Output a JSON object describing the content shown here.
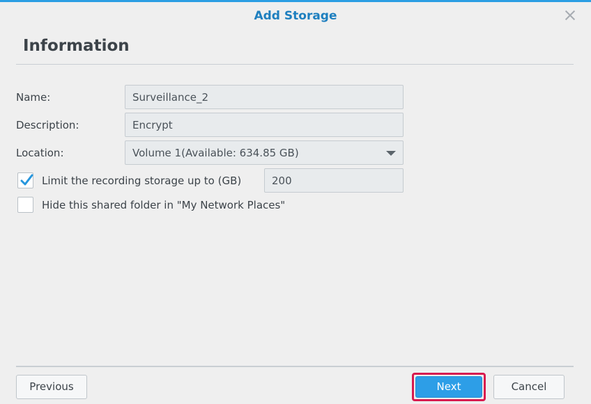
{
  "window": {
    "title": "Add Storage",
    "close_icon": "close-icon"
  },
  "section": {
    "title": "Information"
  },
  "form": {
    "name_label": "Name:",
    "name_value": "Surveillance_2",
    "description_label": "Description:",
    "description_value": "Encrypt",
    "location_label": "Location:",
    "location_value": "Volume 1(Available: 634.85 GB)",
    "limit_label": "Limit the recording storage up to (GB)",
    "limit_checked": true,
    "limit_value": "200",
    "hide_label": "Hide this shared folder in \"My Network Places\"",
    "hide_checked": false
  },
  "footer": {
    "previous_label": "Previous",
    "next_label": "Next",
    "cancel_label": "Cancel"
  },
  "colors": {
    "accent": "#2d9ee7",
    "title": "#1e7fbf",
    "highlight": "#d81b4f"
  }
}
